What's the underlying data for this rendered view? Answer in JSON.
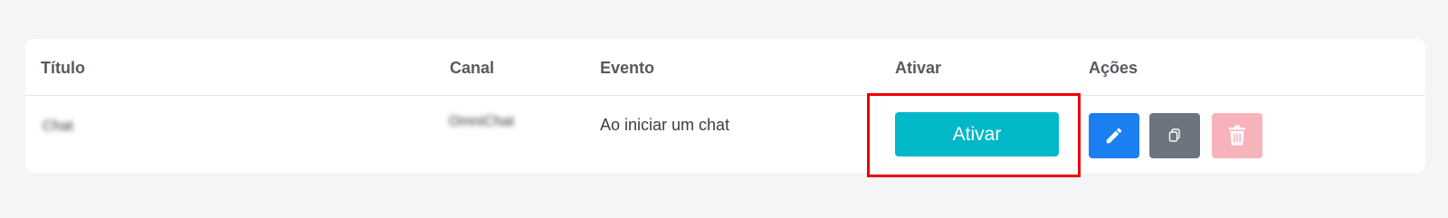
{
  "table": {
    "headers": {
      "titulo": "Título",
      "canal": "Canal",
      "evento": "Evento",
      "ativar": "Ativar",
      "acoes": "Ações"
    },
    "rows": [
      {
        "titulo": "Chat",
        "canal": "OmniChat",
        "evento": "Ao iniciar um chat",
        "ativar_label": "Ativar",
        "actions": [
          "pencil-icon",
          "copy-icon",
          "trash-icon"
        ]
      }
    ]
  },
  "colors": {
    "ativar_button": "#00b8c8",
    "edit_button": "#1a7ff0",
    "copy_button": "#6c757d",
    "delete_button": "#f7b3bc",
    "highlight_box": "#ee0000"
  }
}
